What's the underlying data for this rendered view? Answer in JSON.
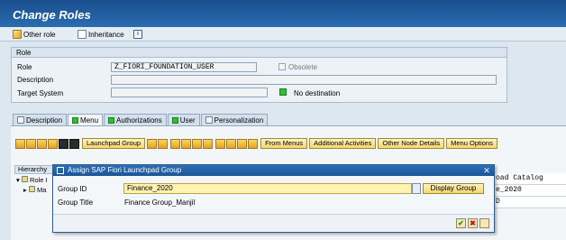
{
  "window": {
    "title": "Change Roles"
  },
  "toolbar": {
    "other_role": "Other role",
    "inheritance": "Inheritance",
    "info_glyph": "i"
  },
  "role_section": {
    "header": "Role",
    "role_label": "Role",
    "role_value": "Z_FIORI_FOUNDATION_USER",
    "obsolete_label": "Obsolete",
    "description_label": "Description",
    "description_value": "",
    "target_system_label": "Target System",
    "target_system_value": "",
    "destination_status": "No destination"
  },
  "tabs": [
    {
      "label": "Description",
      "status": "none"
    },
    {
      "label": "Menu",
      "status": "green"
    },
    {
      "label": "Authorizations",
      "status": "green"
    },
    {
      "label": "User",
      "status": "green"
    },
    {
      "label": "Personalization",
      "status": "none"
    }
  ],
  "menu_toolbar": {
    "launchpad_group": "Launchpad Group",
    "from_menus": "From Menus",
    "additional_activities": "Additional Activities",
    "other_node_details": "Other Node Details",
    "menu_options": "Menu Options"
  },
  "hierarchy": {
    "header": "Hierarchy",
    "root_label": "Role I",
    "child_label": "Ma"
  },
  "right_cells": [
    "oad Catalog",
    "e_2020",
    "D"
  ],
  "dialog": {
    "title": "Assign SAP Fiori Launchpad Group",
    "group_id_label": "Group ID",
    "group_id_value": "Finance_2020",
    "group_title_label": "Group Title",
    "group_title_value": "Finance Group_Manjil",
    "display_group_button": "Display Group",
    "close_glyph": "✕",
    "ok_glyph": "✔",
    "cancel_glyph": "✖"
  },
  "colors": {
    "titlebar": "#1a4e8d",
    "status_green": "#2fbf2f",
    "input_focus": "#fff3b0"
  }
}
